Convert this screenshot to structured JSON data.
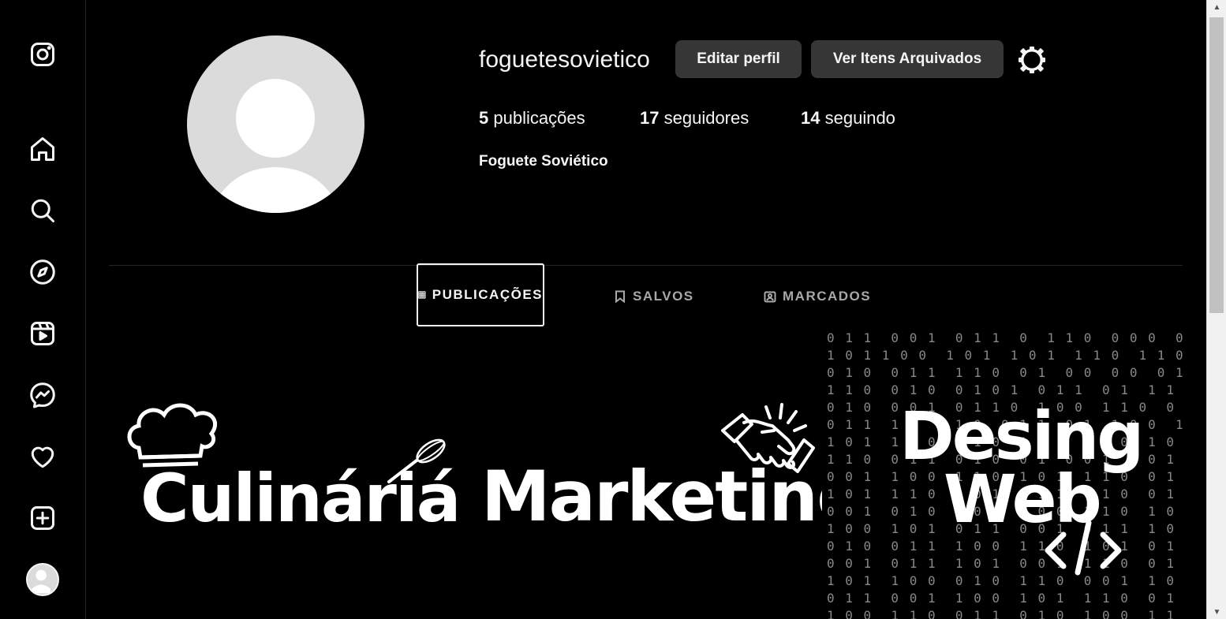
{
  "profile": {
    "username": "foguetesovietico",
    "full_name": "Foguete Soviético",
    "buttons": {
      "edit": "Editar perfil",
      "archive": "Ver Itens Arquivados"
    },
    "stats": {
      "posts_count": "5",
      "posts_label": "publicações",
      "followers_count": "17",
      "followers_label": "seguidores",
      "following_count": "14",
      "following_label": "seguindo"
    }
  },
  "tabs": [
    {
      "label": "PUBLICAÇÕES",
      "icon": "grid-icon",
      "active": true
    },
    {
      "label": "SALVOS",
      "icon": "bookmark-icon",
      "active": false
    },
    {
      "label": "MARCADOS",
      "icon": "tagged-icon",
      "active": false
    }
  ],
  "posts": [
    {
      "text": "Culináriá",
      "icon": "chef-hat-icon"
    },
    {
      "text": "Marketing",
      "icon": "handshake-icon"
    },
    {
      "line1": "Desing",
      "line2": "Web",
      "icon": "code-icon"
    }
  ],
  "sidebar": {
    "items": [
      "instagram-logo-icon",
      "home-icon",
      "search-icon",
      "explore-icon",
      "reels-icon",
      "messenger-icon",
      "heart-icon",
      "create-icon",
      "profile-avatar"
    ]
  },
  "colors": {
    "background": "#000000",
    "button_bg": "#363636",
    "text": "#f5f5f5",
    "muted": "#a8a8a8",
    "avatar": "#dbdbdb"
  }
}
